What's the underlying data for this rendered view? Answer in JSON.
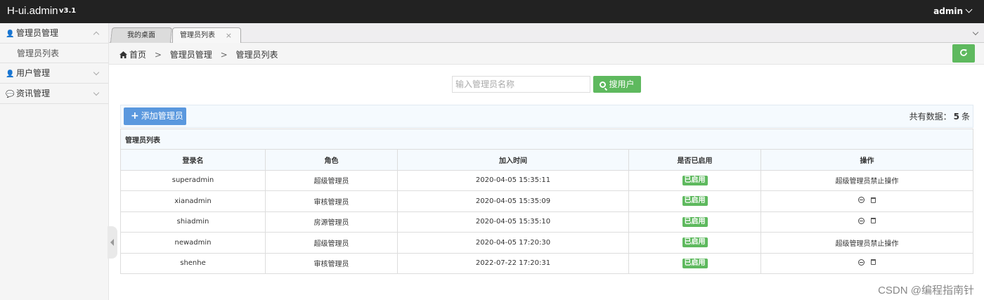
{
  "topbar": {
    "brand": "H-ui.admin",
    "version": "v3.1",
    "user": "admin"
  },
  "sidebar": {
    "groups": [
      {
        "label": "管理员管理",
        "icon": "user-icon",
        "items": [
          {
            "label": "管理员列表"
          }
        ]
      },
      {
        "label": "用户管理",
        "icon": "user-icon"
      },
      {
        "label": "资讯管理",
        "icon": "chat-icon"
      }
    ]
  },
  "tabs": [
    {
      "label": "我的桌面"
    },
    {
      "label": "管理员列表",
      "close": "×"
    }
  ],
  "breadcrumb": {
    "home": "首页",
    "level1": "管理员管理",
    "level2": "管理员列表",
    "sep": ">"
  },
  "search": {
    "placeholder": "输入管理员名称",
    "value": "",
    "button_label": "搜用户"
  },
  "toolbar": {
    "add_label": "添加管理员",
    "add_icon": "plus-icon",
    "total_prefix": "共有数据：",
    "total_count": "5",
    "total_suffix": "条"
  },
  "table": {
    "caption": "管理员列表",
    "columns": [
      "登录名",
      "角色",
      "加入时间",
      "是否已启用",
      "操作"
    ],
    "rows": [
      {
        "login": "superadmin",
        "role": "超级管理员",
        "joined": "2020-04-05 15:35:11",
        "status": "已启用",
        "op": "超级管理员禁止操作"
      },
      {
        "login": "xianadmin",
        "role": "审核管理员",
        "joined": "2020-04-05 15:35:09",
        "status": "已启用",
        "op": ""
      },
      {
        "login": "shiadmin",
        "role": "房源管理员",
        "joined": "2020-04-05 15:35:10",
        "status": "已启用",
        "op": ""
      },
      {
        "login": "newadmin",
        "role": "超级管理员",
        "joined": "2020-04-05 17:20:30",
        "status": "已启用",
        "op": "超级管理员禁止操作"
      },
      {
        "login": "shenhe",
        "role": "审核管理员",
        "joined": "2022-07-22 17:20:31",
        "status": "已启用",
        "op": ""
      }
    ]
  },
  "watermark": "CSDN @编程指南针",
  "colors": {
    "topbar": "#222222",
    "success": "#5eb95e",
    "primary": "#5a98de"
  }
}
